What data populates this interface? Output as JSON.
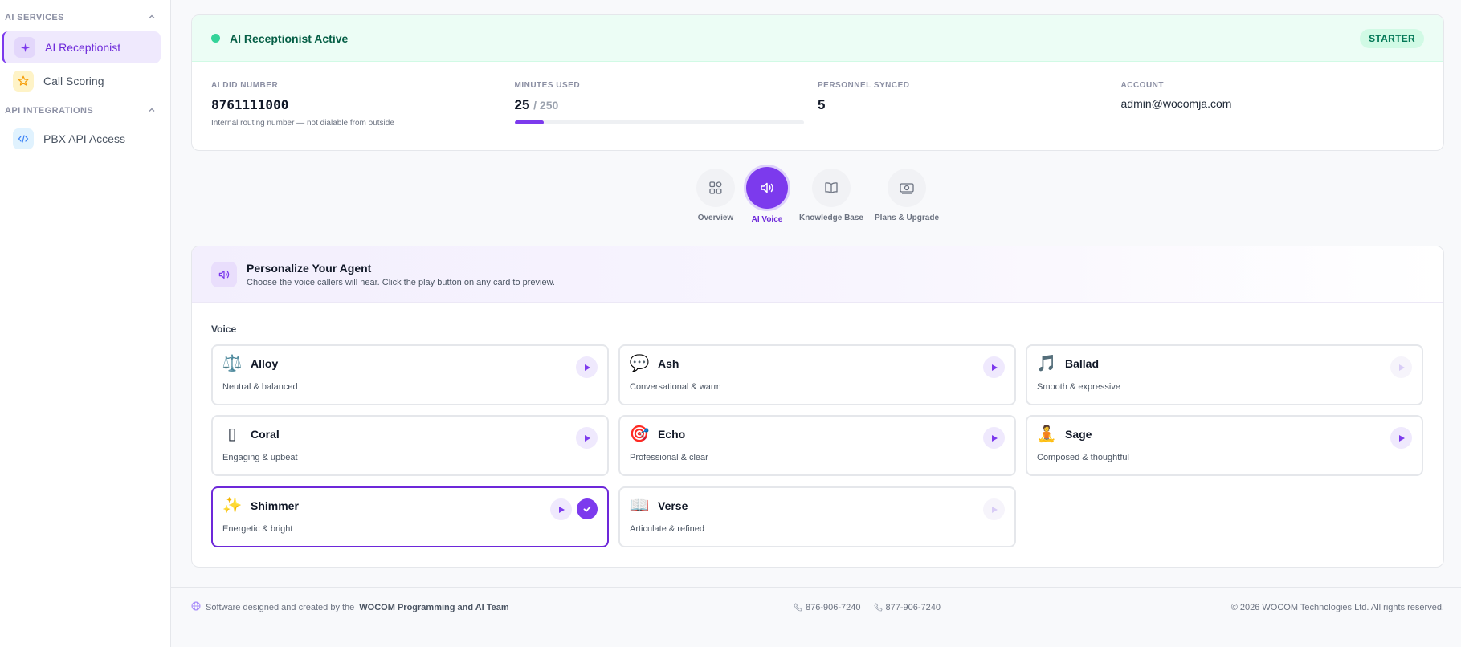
{
  "sidebar": {
    "sections": [
      {
        "title": "AI SERVICES",
        "items": [
          {
            "label": "AI Receptionist",
            "icon": "sparkle-icon",
            "active": true
          },
          {
            "label": "Call Scoring",
            "icon": "star-icon",
            "active": false
          }
        ]
      },
      {
        "title": "API INTEGRATIONS",
        "items": [
          {
            "label": "PBX API Access",
            "icon": "code-icon",
            "active": false
          }
        ]
      }
    ]
  },
  "status": {
    "title": "AI Receptionist Active",
    "plan": "STARTER",
    "stats": {
      "did": {
        "label": "AI DID NUMBER",
        "value": "8761111000",
        "note": "Internal routing number — not dialable from outside"
      },
      "minutes": {
        "label": "MINUTES USED",
        "used": "25",
        "total": "/ 250",
        "fraction": 0.1
      },
      "personnel": {
        "label": "PERSONNEL SYNCED",
        "value": "5"
      },
      "account": {
        "label": "ACCOUNT",
        "value": "admin@wocomja.com"
      }
    }
  },
  "tabs": [
    {
      "label": "Overview",
      "icon": "grid-icon",
      "active": false
    },
    {
      "label": "AI Voice",
      "icon": "speaker-icon",
      "active": true
    },
    {
      "label": "Knowledge Base",
      "icon": "book-icon",
      "active": false
    },
    {
      "label": "Plans & Upgrade",
      "icon": "money-icon",
      "active": false
    }
  ],
  "agent": {
    "title": "Personalize Your Agent",
    "subtitle": "Choose the voice callers will hear. Click the play button on any card to preview.",
    "voice_label": "Voice",
    "voices": [
      {
        "name": "Alloy",
        "desc": "Neutral & balanced",
        "emoji": "⚖️",
        "selected": false,
        "play_enabled": true
      },
      {
        "name": "Ash",
        "desc": "Conversational & warm",
        "emoji": "💬",
        "selected": false,
        "play_enabled": true
      },
      {
        "name": "Ballad",
        "desc": "Smooth & expressive",
        "emoji": "🎵",
        "selected": false,
        "play_enabled": false
      },
      {
        "name": "Coral",
        "desc": "Engaging & upbeat",
        "emoji": "▯",
        "selected": false,
        "play_enabled": true
      },
      {
        "name": "Echo",
        "desc": "Professional & clear",
        "emoji": "🎯",
        "selected": false,
        "play_enabled": true
      },
      {
        "name": "Sage",
        "desc": "Composed & thoughtful",
        "emoji": "🧘",
        "selected": false,
        "play_enabled": true
      },
      {
        "name": "Shimmer",
        "desc": "Energetic & bright",
        "emoji": "✨",
        "selected": true,
        "play_enabled": true
      },
      {
        "name": "Verse",
        "desc": "Articulate & refined",
        "emoji": "📖",
        "selected": false,
        "play_enabled": false
      }
    ]
  },
  "footer": {
    "credit_prefix": "Software designed and created by the",
    "credit_team": "WOCOM Programming and AI Team",
    "phone1": "876-906-7240",
    "phone2": "877-906-7240",
    "copyright": "© 2026 WOCOM Technologies Ltd. All rights reserved."
  },
  "colors": {
    "accent": "#7c3aed",
    "success": "#34d399"
  }
}
